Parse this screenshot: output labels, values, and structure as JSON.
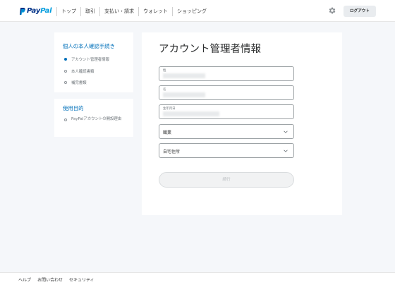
{
  "header": {
    "logo_pay": "Pay",
    "logo_pal": "Pal",
    "nav": [
      "トップ",
      "取引",
      "支払い・請求",
      "ウォレット",
      "ショッピング"
    ],
    "logout_label": "ログアウト",
    "gear_icon": "gear-icon"
  },
  "sidebar": {
    "section1_title": "個人の本人確認手続き",
    "steps": [
      "アカウント管理者情報",
      "本人確認書類",
      "補完書類"
    ],
    "active_step": 0,
    "section2_title": "使用目的",
    "purpose_item": "PayPalアカウントの開設理由"
  },
  "form": {
    "title": "アカウント管理者情報",
    "surname_label": "姓",
    "given_name_label": "名",
    "dob_label": "生年月日",
    "occupation_label": "職業",
    "address_label": "自宅住所",
    "continue_label": "続行"
  },
  "footer": {
    "links": [
      "ヘルプ",
      "お問い合わせ",
      "セキュリティ"
    ]
  },
  "colors": {
    "accent": "#0070ba",
    "navy": "#003087",
    "light_blue": "#009cde"
  }
}
